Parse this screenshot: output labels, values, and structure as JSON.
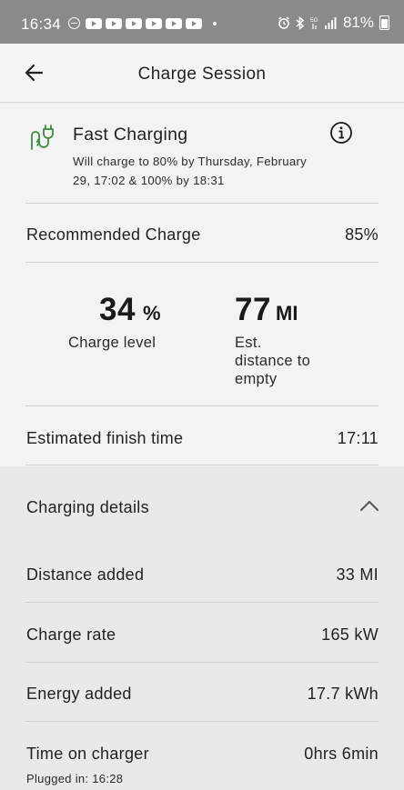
{
  "status_bar": {
    "time": "16:34",
    "battery": "81%",
    "icons": [
      "dnd-icon",
      "youtube-icon",
      "youtube-icon",
      "youtube-icon",
      "youtube-icon",
      "youtube-icon",
      "youtube-icon",
      "dot-icon",
      "alarm-icon",
      "bluetooth-icon",
      "5g-icon",
      "signal-icon",
      "battery-icon"
    ]
  },
  "header": {
    "title": "Charge Session",
    "back_icon": "arrow-left-icon"
  },
  "charging_status": {
    "icon": "charging-plug-icon",
    "title": "Fast Charging",
    "description": "Will charge to 80% by Thursday, February 29, 17:02 & 100% by 18:31",
    "info_icon": "info-icon"
  },
  "recommended": {
    "label": "Recommended Charge",
    "value": "85%"
  },
  "stats": {
    "charge_level": {
      "value": "34",
      "unit": "%",
      "label": "Charge level"
    },
    "distance": {
      "value": "77",
      "unit": "MI",
      "label_lines": [
        "Est.",
        "distance to",
        "empty"
      ]
    }
  },
  "finish": {
    "label": "Estimated finish time",
    "value": "17:11"
  },
  "details": {
    "title": "Charging details",
    "chevron_icon": "chevron-up-icon",
    "rows": [
      {
        "label": "Distance added",
        "value": "33 MI"
      },
      {
        "label": "Charge rate",
        "value": "165 kW"
      },
      {
        "label": "Energy added",
        "value": "17.7 kWh"
      },
      {
        "label": "Time on charger",
        "value": "0hrs 6min"
      }
    ],
    "plugged_in": "Plugged in: 16:28"
  },
  "colors": {
    "accent_green": "#3d8b3d",
    "status_bar": "#8a8a8a",
    "details_bg": "#e9e9ea"
  }
}
